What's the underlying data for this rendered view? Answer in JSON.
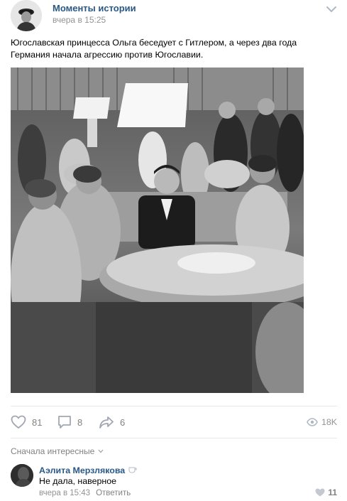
{
  "post": {
    "author": "Моменты истории",
    "time": "вчера в 15:25",
    "text": "Югославская принцесса Ольга беседует с Гитлером, а через два года Германия начала агрессию против Югославии.",
    "photo_icon": "historical-photo"
  },
  "actions": {
    "likes": "81",
    "comments": "8",
    "shares": "6",
    "views": "18K",
    "like_icon": "heart-icon",
    "comment_icon": "comment-icon",
    "share_icon": "share-icon",
    "views_icon": "eye-icon"
  },
  "comments_section": {
    "sort_label": "Сначала интересные",
    "items": [
      {
        "author": "Аэлита Мерзлякова",
        "text": "Не дала, наверное",
        "time": "вчера в 15:43",
        "reply_label": "Ответить",
        "likes": "11"
      }
    ]
  },
  "colors": {
    "link": "#2a5885",
    "muted": "#828282",
    "divider": "#e7e8ec"
  }
}
